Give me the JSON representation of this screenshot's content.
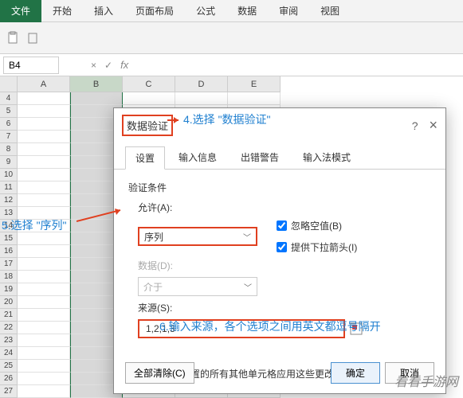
{
  "ribbon": {
    "file": "文件",
    "tabs": [
      "开始",
      "插入",
      "页面布局",
      "公式",
      "数据",
      "审阅",
      "视图"
    ]
  },
  "namebox": {
    "value": "B4",
    "fx": "fx"
  },
  "sheet": {
    "cols": [
      "A",
      "B",
      "C",
      "D",
      "E"
    ],
    "rows": [
      "4",
      "5",
      "6",
      "7",
      "8",
      "9",
      "10",
      "11",
      "12",
      "13",
      "14",
      "15",
      "16",
      "17",
      "18",
      "19",
      "20",
      "21",
      "22",
      "23",
      "24",
      "25",
      "26",
      "27"
    ]
  },
  "dialog": {
    "title": "数据验证",
    "help": "?",
    "close": "×",
    "tabs": {
      "t1": "设置",
      "t2": "输入信息",
      "t3": "出错警告",
      "t4": "输入法模式"
    },
    "section": "验证条件",
    "allow_label": "允许(A):",
    "allow_value": "序列",
    "ignore_blank": "忽略空值(B)",
    "dropdown_arrow": "提供下拉箭头(I)",
    "data_label": "数据(D):",
    "data_value": "介于",
    "source_label": "来源(S):",
    "source_value": "1,2,1,3",
    "apply_all": "对有同样设置的所有其他单元格应用这些更改(P)",
    "clear": "全部清除(C)",
    "ok": "确定",
    "cancel": "取消"
  },
  "annotations": {
    "a4": "4.选择 \"数据验证\"",
    "a5": "5.选择 \"序列\"",
    "a6": "6.输入来源，各个选项之间用英文都逗号隔开"
  },
  "watermark": "看看手游网"
}
